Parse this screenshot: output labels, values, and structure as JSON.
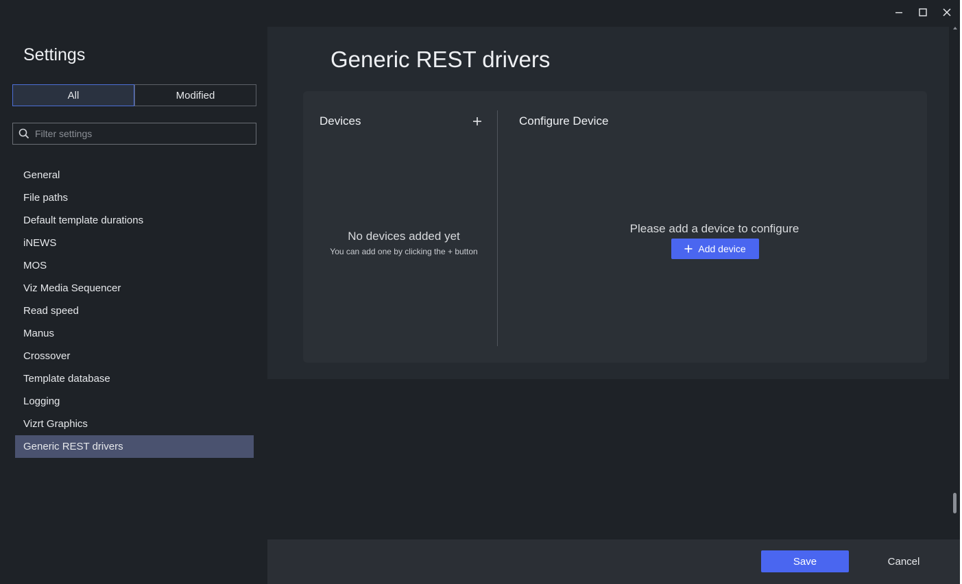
{
  "window": {
    "controls": [
      "minimize-icon",
      "maximize-icon",
      "close-icon"
    ]
  },
  "sidebar": {
    "title": "Settings",
    "filter_tabs": {
      "all": "All",
      "modified": "Modified",
      "active": "All"
    },
    "search": {
      "placeholder": "Filter settings",
      "value": "",
      "icon": "search-icon"
    },
    "items": [
      {
        "label": "General"
      },
      {
        "label": "File paths"
      },
      {
        "label": "Default template durations"
      },
      {
        "label": "iNEWS"
      },
      {
        "label": "MOS"
      },
      {
        "label": "Viz Media Sequencer"
      },
      {
        "label": "Read speed"
      },
      {
        "label": "Manus"
      },
      {
        "label": "Crossover"
      },
      {
        "label": "Template database"
      },
      {
        "label": "Logging"
      },
      {
        "label": "Vizrt Graphics"
      },
      {
        "label": "Generic REST drivers",
        "selected": true
      }
    ]
  },
  "main": {
    "title": "Generic REST drivers",
    "devices": {
      "header": "Devices",
      "add_icon": "plus-icon",
      "empty_title": "No devices added yet",
      "empty_hint": "You can add one by clicking the + button"
    },
    "configure": {
      "header": "Configure Device",
      "message": "Please add a device to configure",
      "add_button": "Add device"
    }
  },
  "footer": {
    "save_label": "Save",
    "cancel_label": "Cancel"
  },
  "colors": {
    "accent": "#4a66f0",
    "selected_item": "#4a526f",
    "background": "#1e2227",
    "panel": "#252a30",
    "card": "#2b3036"
  }
}
